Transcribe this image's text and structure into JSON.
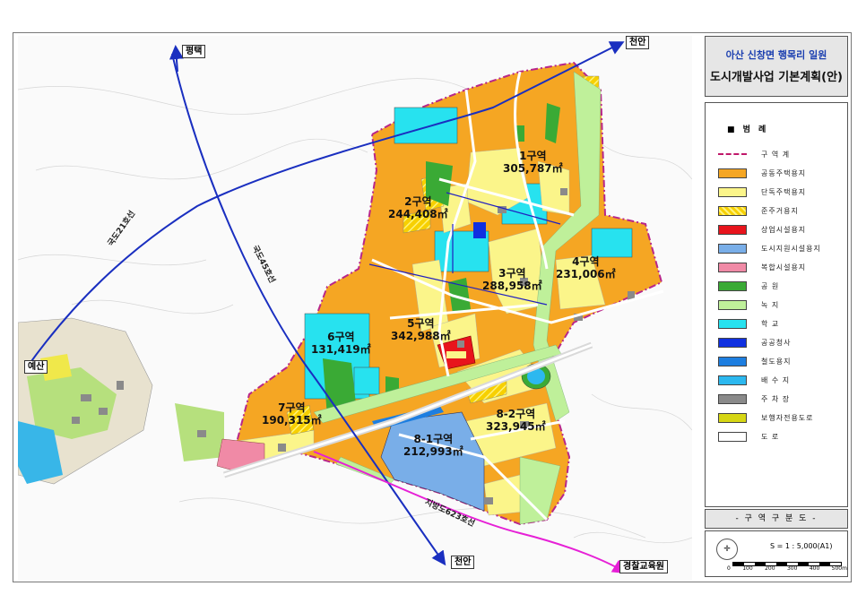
{
  "title": {
    "line1": "아산 신창면 행목리 일원",
    "line2": "도시개발사업 기본계획(안)"
  },
  "legend": {
    "heading": "■ 범 례",
    "items": [
      {
        "label": "구 역 계",
        "color": "#ffffff",
        "style": "dash"
      },
      {
        "label": "공동주택용지",
        "color": "#f5a623"
      },
      {
        "label": "단독주택용지",
        "color": "#fbf58a"
      },
      {
        "label": "준주거용지",
        "color": "#f7d000",
        "style": "hatch"
      },
      {
        "label": "상업시설용지",
        "color": "#e8141c"
      },
      {
        "label": "도시지원시설용지",
        "color": "#79aee8"
      },
      {
        "label": "복합시설용지",
        "color": "#f08aa6"
      },
      {
        "label": "공 원",
        "color": "#3aaa35"
      },
      {
        "label": "녹 지",
        "color": "#bff09a"
      },
      {
        "label": "학 교",
        "color": "#27e2ef"
      },
      {
        "label": "공공청사",
        "color": "#1030e0"
      },
      {
        "label": "철도용지",
        "color": "#1d7ee0"
      },
      {
        "label": "배 수 지",
        "color": "#2cb8ef"
      },
      {
        "label": "주 차 장",
        "color": "#8a8a8a"
      },
      {
        "label": "보행자전용도로",
        "color": "#d6d614"
      },
      {
        "label": "도 로",
        "color": "#ffffff"
      }
    ]
  },
  "footer": {
    "label": "- 구 역 구 분 도 -",
    "scale": "S = 1 : 5,000(A1)",
    "ticks": [
      "0",
      "100",
      "200",
      "300",
      "400",
      "500m"
    ]
  },
  "cities": {
    "pyeongtaek": "평택",
    "cheonan_top": "천안",
    "yesan": "예산",
    "cheonan_bottom": "천안",
    "police_academy": "경찰교육원"
  },
  "roads": {
    "r21": "국도21호선",
    "r45": "국도45호선",
    "r623": "지방도623호선"
  },
  "zones": [
    {
      "name": "1구역",
      "area": "305,787㎡"
    },
    {
      "name": "2구역",
      "area": "244,408㎡"
    },
    {
      "name": "3구역",
      "area": "288,958㎡"
    },
    {
      "name": "4구역",
      "area": "231,006㎡"
    },
    {
      "name": "5구역",
      "area": "342,988㎡"
    },
    {
      "name": "6구역",
      "area": "131,419㎡"
    },
    {
      "name": "7구역",
      "area": "190,315㎡"
    },
    {
      "name": "8-1구역",
      "area": "212,993㎡"
    },
    {
      "name": "8-2구역",
      "area": "323,945㎡"
    }
  ]
}
